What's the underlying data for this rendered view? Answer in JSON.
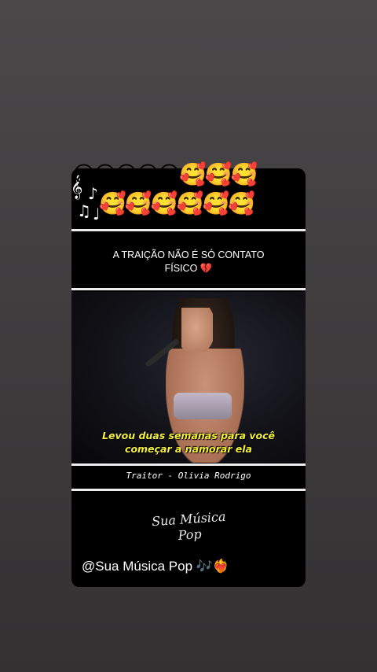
{
  "story": {
    "emoji_row_1": "😍😍😍😍😍🥰🥰🥰",
    "emoji_row_2": "🥰🥰🥰🥰🥰🥰",
    "headline_line1": "A TRAIÇÃO NÃO É SÓ CONTATO",
    "headline_line2": "FÍSICO 💔",
    "subtitle_line1": "Levou duas semanas para você",
    "subtitle_line2": "começar a namorar ela",
    "song_credit": "Traitor - Olivia Rodrigo",
    "signature_line1": "Sua Música",
    "signature_line2": "Pop",
    "handle": "@Sua Música Pop 🎶❤️‍🔥"
  },
  "decorations": {
    "music_notes": [
      "𝄞",
      "♪",
      "♫",
      "♩"
    ]
  },
  "colors": {
    "card_bg": "#000000",
    "subtitle": "#f4f03a",
    "page_bg": "#403e3f"
  }
}
